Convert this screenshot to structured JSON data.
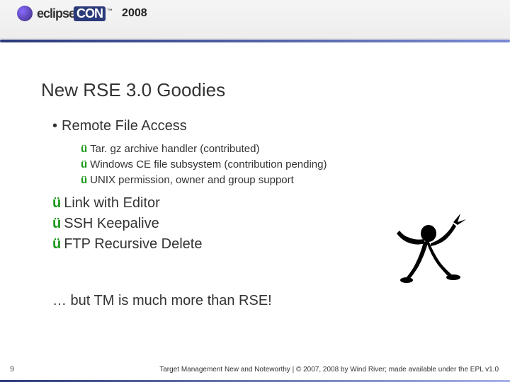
{
  "header": {
    "logo_prefix": "eclipse",
    "logo_suffix": "CON",
    "tm": "™",
    "year": "2008"
  },
  "slide": {
    "title": "New RSE 3.0 Goodies",
    "section1_label": "Remote File Access",
    "section1_items": [
      "Tar. gz archive handler (contributed)",
      "Windows CE file subsystem (contribution pending)",
      "UNIX permission, owner and group support"
    ],
    "features": [
      "Link with Editor",
      "SSH Keepalive",
      "FTP Recursive Delete"
    ],
    "closing": "… but TM is much more than RSE!"
  },
  "footer": {
    "page": "9",
    "text": "Target Management New and Noteworthy | © 2007, 2008 by Wind River; made available under the EPL v1.0"
  }
}
